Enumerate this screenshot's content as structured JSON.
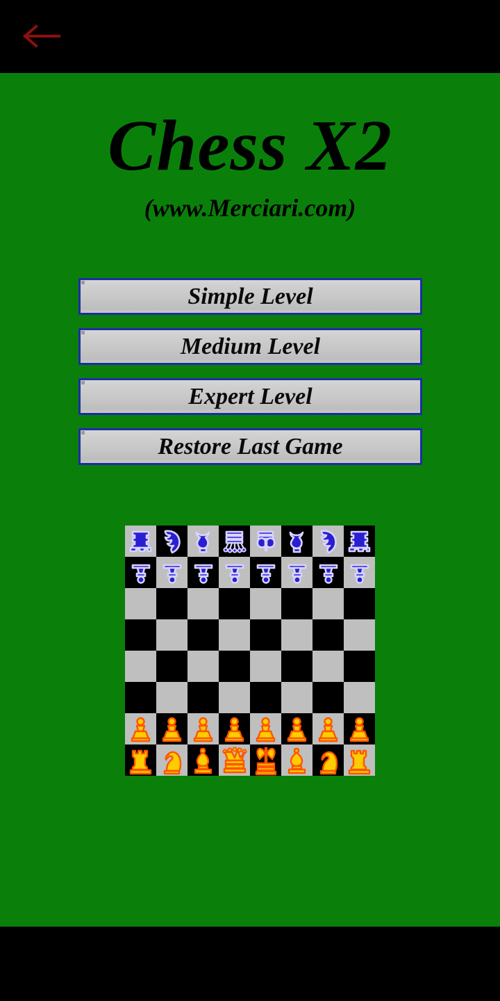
{
  "system": {
    "back_icon": "back-arrow-icon",
    "back_arrow_color": "#8b0f0f",
    "topbar_color": "#000000",
    "bottombar_color": "#000000"
  },
  "app": {
    "background_color": "#0a800a",
    "title": "Chess X2",
    "subtitle": "(www.Merciari.com)"
  },
  "menu": {
    "buttons": [
      {
        "id": "simple-level",
        "label": "Simple Level"
      },
      {
        "id": "medium-level",
        "label": "Medium Level"
      },
      {
        "id": "expert-level",
        "label": "Expert Level"
      },
      {
        "id": "restore-last-game",
        "label": "Restore Last Game"
      }
    ],
    "border_color": "#1c2ea5",
    "face_color": "#c8c8c8",
    "label_color": "#0a0a0a"
  },
  "board": {
    "light_square_color": "#bfbfbf",
    "dark_square_color": "#000000",
    "square_size": 45,
    "files": 8,
    "ranks": 8,
    "blue_piece_color": "#2a1fd0",
    "blue_piece_outline": "#d8d4ff",
    "orange_piece_color": "#ffcc00",
    "orange_piece_outline": "#ff5500",
    "rows": [
      {
        "rank": 8,
        "pieces": [
          "rook",
          "knight",
          "bishop",
          "queen",
          "king",
          "bishop",
          "knight",
          "rook"
        ],
        "side": "blue"
      },
      {
        "rank": 7,
        "pieces": [
          "pawn",
          "pawn",
          "pawn",
          "pawn",
          "pawn",
          "pawn",
          "pawn",
          "pawn"
        ],
        "side": "blue"
      },
      {
        "rank": 6,
        "pieces": [
          "",
          "",
          "",
          "",
          "",
          "",
          "",
          ""
        ],
        "side": ""
      },
      {
        "rank": 5,
        "pieces": [
          "",
          "",
          "",
          "",
          "",
          "",
          "",
          ""
        ],
        "side": ""
      },
      {
        "rank": 4,
        "pieces": [
          "",
          "",
          "",
          "",
          "",
          "",
          "",
          ""
        ],
        "side": ""
      },
      {
        "rank": 3,
        "pieces": [
          "",
          "",
          "",
          "",
          "",
          "",
          "",
          ""
        ],
        "side": ""
      },
      {
        "rank": 2,
        "pieces": [
          "pawn",
          "pawn",
          "pawn",
          "pawn",
          "pawn",
          "pawn",
          "pawn",
          "pawn"
        ],
        "side": "orange"
      },
      {
        "rank": 1,
        "pieces": [
          "rook",
          "knight",
          "bishop",
          "queen",
          "king",
          "bishop",
          "knight",
          "rook"
        ],
        "side": "orange"
      }
    ]
  }
}
